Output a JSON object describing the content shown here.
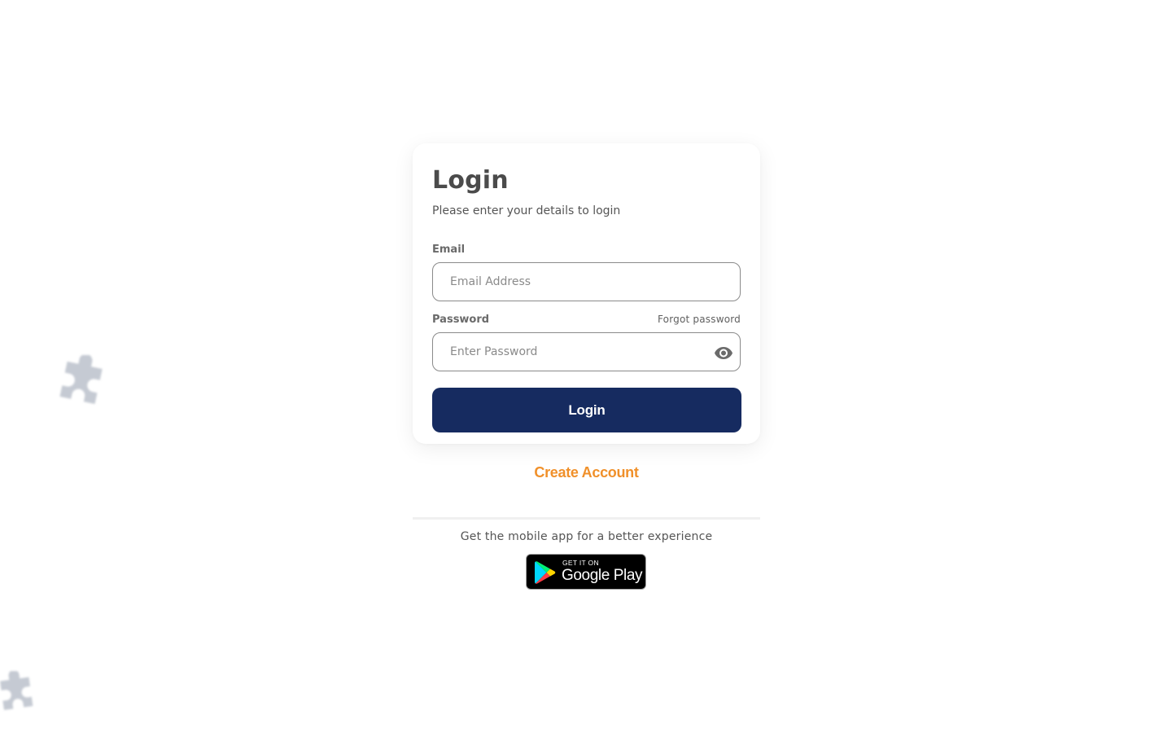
{
  "login_card": {
    "title": "Login",
    "subtitle": "Please enter your details to login",
    "email": {
      "label": "Email",
      "placeholder": "Email Address",
      "value": ""
    },
    "password": {
      "label": "Password",
      "placeholder": "Enter Password",
      "value": "",
      "forgot_link": "Forgot password",
      "toggle_icon": "eye-icon"
    },
    "submit_label": "Login"
  },
  "create_account_label": "Create Account",
  "mobile_app": {
    "text": "Get the mobile app for a better experience",
    "badge_top": "GET IT ON",
    "badge_name": "Google Play"
  },
  "colors": {
    "primary": "#162b60",
    "accent": "#f0902a",
    "decoration": "#c8cdd6"
  },
  "decorations": [
    "puzzle-piece-icon",
    "puzzle-piece-icon"
  ]
}
